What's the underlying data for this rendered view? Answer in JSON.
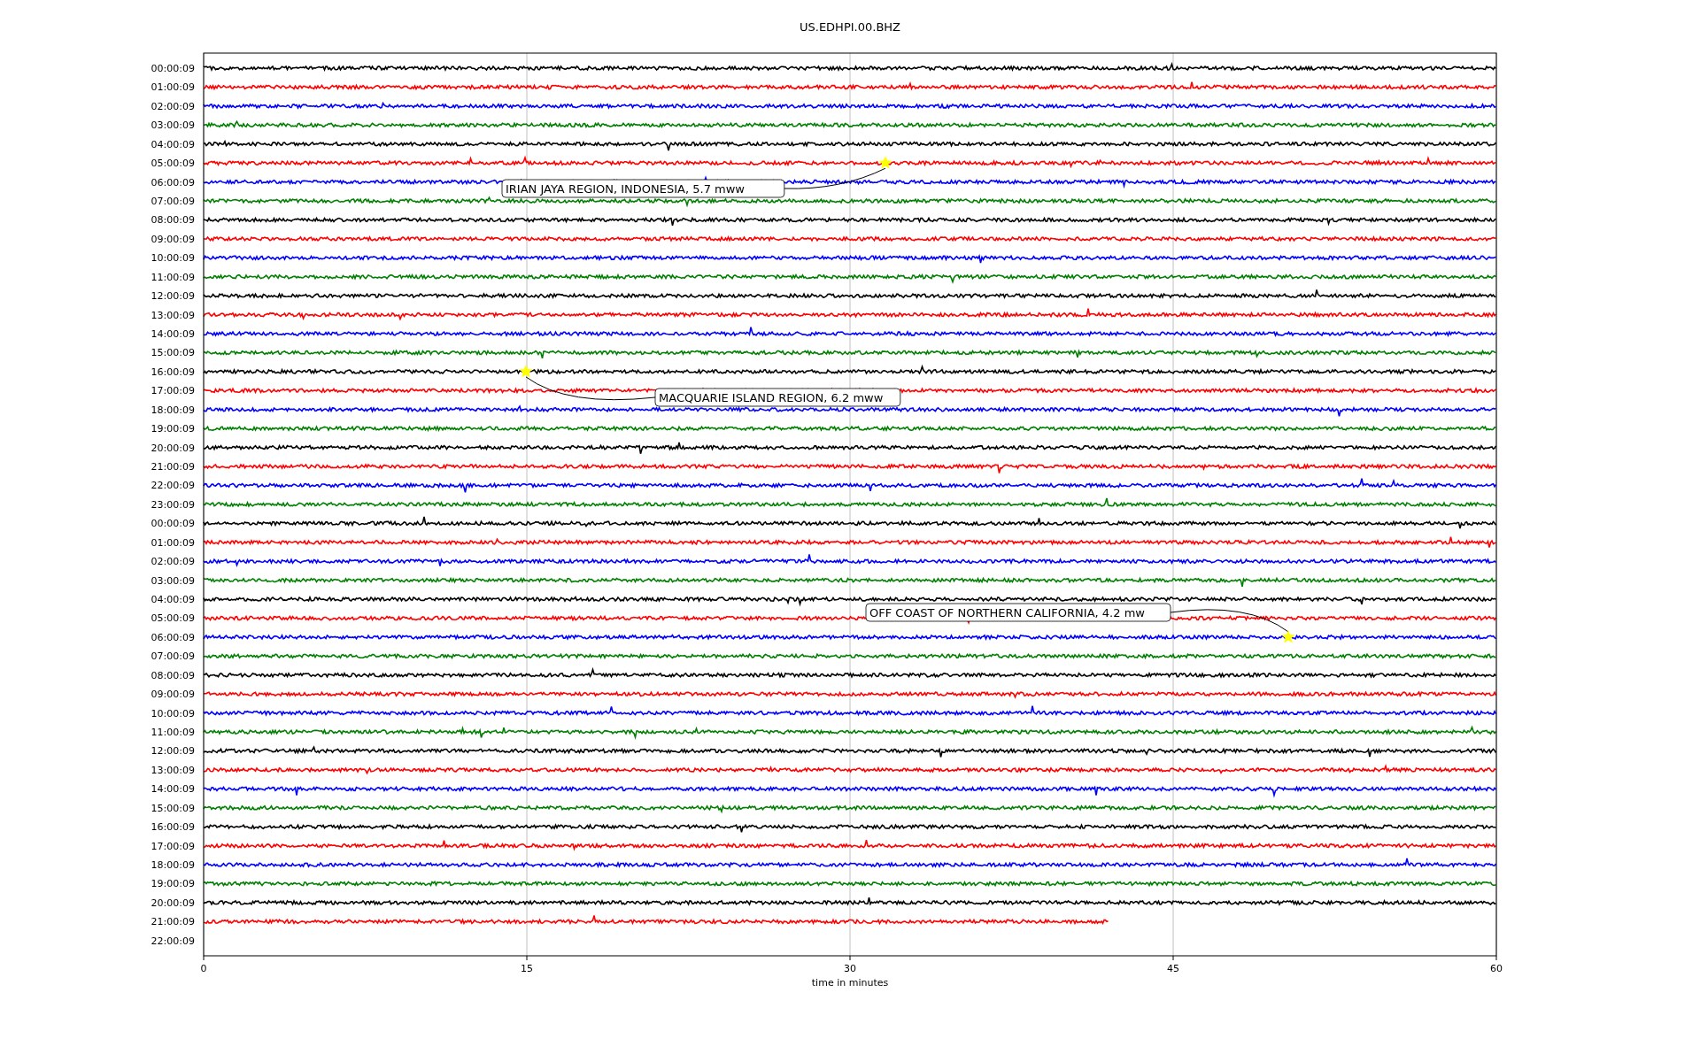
{
  "title": "US.EDHPI.00.BHZ",
  "rows": [
    {
      "label": "00:00:09",
      "color": "#000000",
      "level": 1
    },
    {
      "label": "01:00:09",
      "color": "#ff0000",
      "level": 1
    },
    {
      "label": "02:00:09",
      "color": "#0000ff",
      "level": 1
    },
    {
      "label": "03:00:09",
      "color": "#008000",
      "level": 1
    },
    {
      "label": "04:00:09",
      "color": "#000000",
      "level": 1
    },
    {
      "label": "05:00:09",
      "color": "#ff0000",
      "level": 1,
      "event": "IRIAN JAYA REGION, INDONESIA, 5.7 mww"
    },
    {
      "label": "06:00:09",
      "color": "#0000ff",
      "level": 1
    },
    {
      "label": "07:00:09",
      "color": "#008000",
      "level": 1
    },
    {
      "label": "08:00:09",
      "color": "#000000",
      "level": 1
    },
    {
      "label": "09:00:09",
      "color": "#ff0000",
      "level": 1
    },
    {
      "label": "10:00:09",
      "color": "#0000ff",
      "level": 1
    },
    {
      "label": "11:00:09",
      "color": "#008000",
      "level": 1
    },
    {
      "label": "12:00:09",
      "color": "#000000",
      "level": 1
    },
    {
      "label": "13:00:09",
      "color": "#ff0000",
      "level": 1
    },
    {
      "label": "14:00:09",
      "color": "#0000ff",
      "level": 1
    },
    {
      "label": "15:00:09",
      "color": "#008000",
      "level": 1
    },
    {
      "label": "16:00:09",
      "color": "#000000",
      "level": 1,
      "event": "MACQUARIE ISLAND REGION, 6.2 mww"
    },
    {
      "label": "17:00:09",
      "color": "#ff0000",
      "level": 1
    },
    {
      "label": "18:00:09",
      "color": "#0000ff",
      "level": 1
    },
    {
      "label": "19:00:09",
      "color": "#008000",
      "level": 1
    },
    {
      "label": "20:00:09",
      "color": "#000000",
      "level": 1
    },
    {
      "label": "21:00:09",
      "color": "#ff0000",
      "level": 1
    },
    {
      "label": "22:00:09",
      "color": "#0000ff",
      "level": 1
    },
    {
      "label": "23:00:09",
      "color": "#008000",
      "level": 1
    },
    {
      "label": "00:00:09",
      "color": "#000000",
      "level": 1
    },
    {
      "label": "01:00:09",
      "color": "#ff0000",
      "level": 1
    },
    {
      "label": "02:00:09",
      "color": "#0000ff",
      "level": 1
    },
    {
      "label": "03:00:09",
      "color": "#008000",
      "level": 1
    },
    {
      "label": "04:00:09",
      "color": "#000000",
      "level": 1
    },
    {
      "label": "05:00:09",
      "color": "#ff0000",
      "level": 1
    },
    {
      "label": "06:00:09",
      "color": "#0000ff",
      "level": 1,
      "event": "OFF COAST OF NORTHERN CALIFORNIA, 4.2 mw"
    },
    {
      "label": "07:00:09",
      "color": "#008000",
      "level": 1
    },
    {
      "label": "08:00:09",
      "color": "#000000",
      "level": 1
    },
    {
      "label": "09:00:09",
      "color": "#ff0000",
      "level": 1
    },
    {
      "label": "10:00:09",
      "color": "#0000ff",
      "level": 1
    },
    {
      "label": "11:00:09",
      "color": "#008000",
      "level": 1
    },
    {
      "label": "12:00:09",
      "color": "#000000",
      "level": 1
    },
    {
      "label": "13:00:09",
      "color": "#ff0000",
      "level": 1
    },
    {
      "label": "14:00:09",
      "color": "#0000ff",
      "level": 1
    },
    {
      "label": "15:00:09",
      "color": "#008000",
      "level": 1
    },
    {
      "label": "16:00:09",
      "color": "#000000",
      "level": 1
    },
    {
      "label": "17:00:09",
      "color": "#ff0000",
      "level": 1
    },
    {
      "label": "18:00:09",
      "color": "#0000ff",
      "level": 1
    },
    {
      "label": "19:00:09",
      "color": "#008000",
      "level": 1
    },
    {
      "label": "20:00:09",
      "color": "#000000",
      "level": 1
    },
    {
      "label": "21:00:09",
      "color": "#ff0000",
      "level": 0.7
    },
    {
      "label": "22:00:09"
    }
  ],
  "x_axis": {
    "ticks": [
      "0",
      "15",
      "30",
      "45",
      "60"
    ],
    "label": "time in minutes"
  }
}
